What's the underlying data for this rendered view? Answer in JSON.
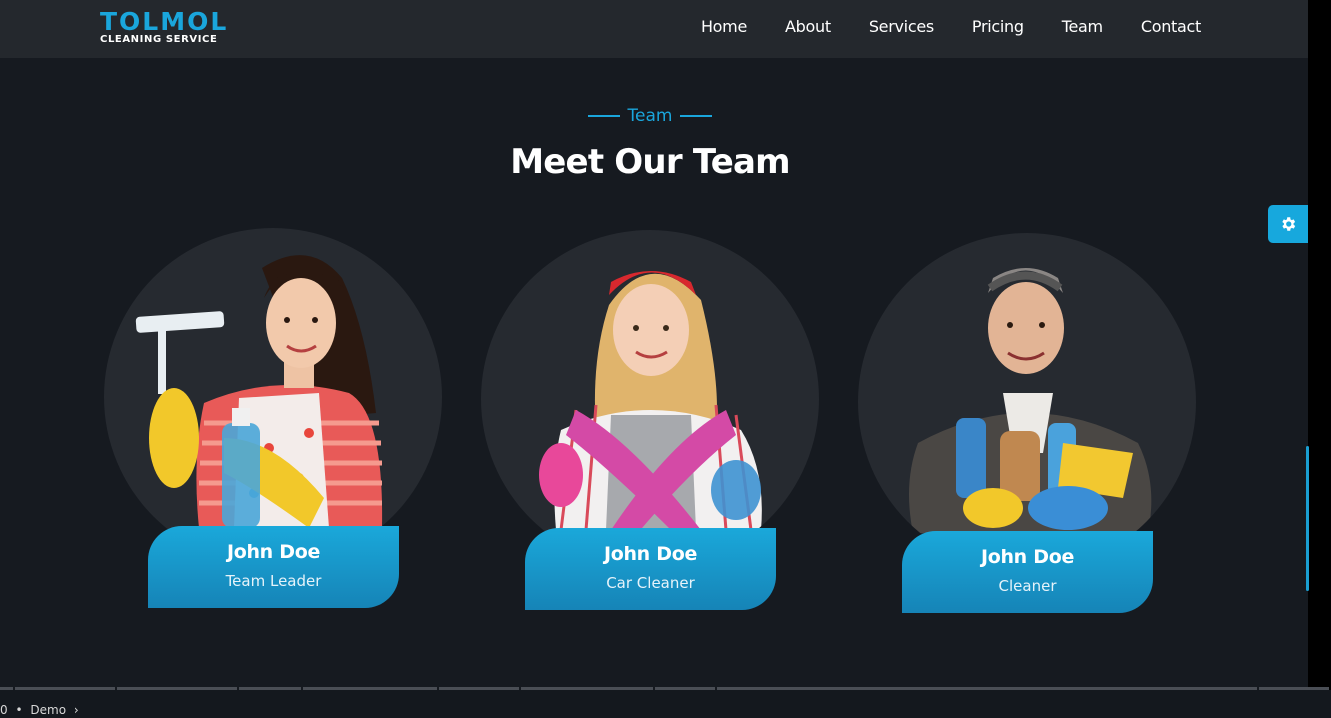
{
  "logo": {
    "title": "TOLMOL",
    "subtitle": "CLEANING SERVICE"
  },
  "nav": {
    "items": [
      {
        "label": "Home"
      },
      {
        "label": "About"
      },
      {
        "label": "Services"
      },
      {
        "label": "Pricing"
      },
      {
        "label": "Team"
      },
      {
        "label": "Contact"
      }
    ]
  },
  "section": {
    "eyebrow": "Team",
    "title": "Meet Our Team"
  },
  "team": [
    {
      "name": "John Doe",
      "role": "Team Leader"
    },
    {
      "name": "John Doe",
      "role": "Car Cleaner"
    },
    {
      "name": "John Doe",
      "role": "Cleaner"
    }
  ],
  "bottom_bar": {
    "chapter_index": "0",
    "separator": "•",
    "chapter_label": "Demo",
    "chevron": "›"
  },
  "colors": {
    "accent": "#1aa6dc",
    "background": "#161a20",
    "navbar": "#24282d",
    "card_circle": "#262a30"
  }
}
